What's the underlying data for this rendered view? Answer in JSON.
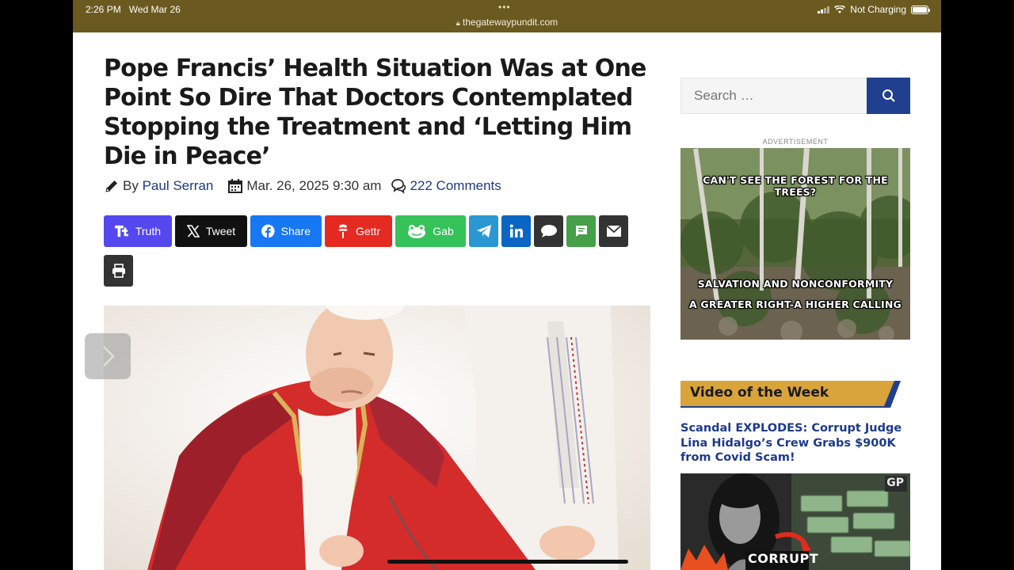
{
  "status_bar": {
    "time": "2:26 PM",
    "date": "Wed Mar 26",
    "url": "thegatewaypundit.com",
    "battery_label": "Not Charging"
  },
  "article": {
    "title": "Pope Francis’ Health Situation Was at One Point So Dire That Doctors Contemplated Stopping the Treatment and ‘Letting Him Die in Peace’",
    "by_label": "By",
    "author": "Paul Serran",
    "date": "Mar. 26, 2025 9:30 am",
    "comments": "222 Comments"
  },
  "share_buttons": [
    {
      "label": "Truth",
      "icon": "truth-icon",
      "color": "#5448ee"
    },
    {
      "label": "Tweet",
      "icon": "x-icon",
      "color": "#000000"
    },
    {
      "label": "Share",
      "icon": "facebook-icon",
      "color": "#1877f2"
    },
    {
      "label": "Gettr",
      "icon": "gettr-icon",
      "color": "#e52a21"
    },
    {
      "label": "Gab",
      "icon": "gab-frog-icon",
      "color": "#35c259"
    },
    {
      "label": "",
      "icon": "telegram-icon",
      "color": "#2a97d3"
    },
    {
      "label": "",
      "icon": "linkedin-icon",
      "color": "#0a66c2"
    },
    {
      "label": "",
      "icon": "comment-bubble-icon",
      "color": "#333333"
    },
    {
      "label": "",
      "icon": "sms-icon",
      "color": "#45a047"
    },
    {
      "label": "",
      "icon": "email-icon",
      "color": "#333333"
    }
  ],
  "print_icon": "printer-icon",
  "sidebar": {
    "search_placeholder": "Search …",
    "ad_label": "ADVERTISEMENT",
    "ad_captions": [
      "CAN'T SEE THE FOREST FOR THE TREES?",
      "SALVATION AND NONCONFORMITY",
      "A GREATER RIGHT-A HIGHER CALLING"
    ],
    "video_section_title": "Video of the Week",
    "video_title": "Scandal EXPLODES: Corrupt Judge Lina Hidalgo’s Crew Grabs $900K from Covid Scam!",
    "video_badge": "GP",
    "video_overlay_text": "CORRUPT"
  },
  "colors": {
    "status_bar": "#6b5a1f",
    "link_blue": "#1d3a8a",
    "search_button": "#213f8f",
    "video_header": "#d9a43a"
  }
}
